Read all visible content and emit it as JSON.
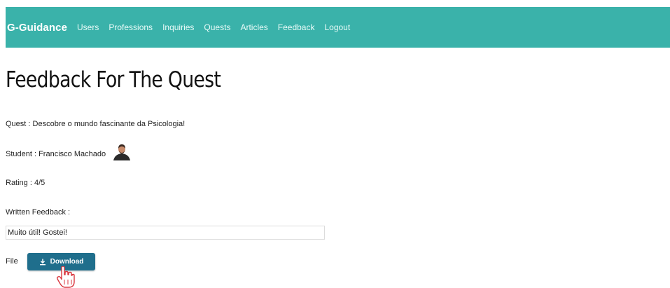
{
  "navbar": {
    "brand": "G-Guidance",
    "links": [
      "Users",
      "Professions",
      "Inquiries",
      "Quests",
      "Articles",
      "Feedback",
      "Logout"
    ]
  },
  "page": {
    "title": "Feedback For The Quest"
  },
  "details": {
    "quest_line": "Quest : Descobre o mundo fascinante da Psicologia!",
    "student_line": "Student : Francisco Machado",
    "rating_line": "Rating : 4/5",
    "written_feedback_label": "Written Feedback :",
    "written_feedback_value": "Muito útil! Gostei!",
    "file_label": "File",
    "download_label": "Download"
  },
  "colors": {
    "navbar_bg": "#3ab2aa",
    "download_button_bg": "#1f6e8c"
  },
  "icons": {
    "download": "download-icon",
    "cursor": "hand-pointer-icon",
    "avatar": "student-avatar"
  }
}
